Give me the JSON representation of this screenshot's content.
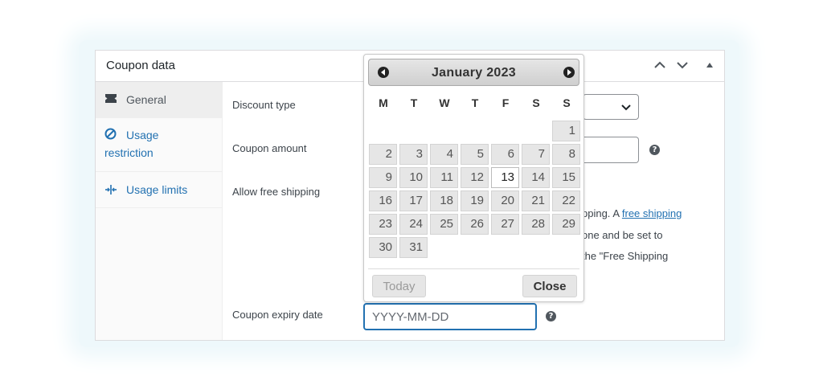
{
  "panel": {
    "title": "Coupon data"
  },
  "tabs": [
    {
      "label": "General",
      "icon": "ticket-icon",
      "active": true
    },
    {
      "label_line1": "Usage",
      "label_line2": "restriction",
      "icon": "block-icon"
    },
    {
      "label": "Usage limits",
      "icon": "limits-icon"
    }
  ],
  "fields": {
    "discount_type_label": "Discount type",
    "coupon_amount_label": "Coupon amount",
    "free_shipping_label": "Allow free shipping",
    "expiry_label": "Coupon expiry date",
    "expiry_placeholder": "YYYY-MM-DD"
  },
  "free_shipping_desc": {
    "line1_prefix": "pping. A ",
    "line1_link": "free shipping",
    "line2": "one and be set to",
    "line3": "the \"Free Shipping"
  },
  "datepicker": {
    "month_title": "January 2023",
    "weekdays": [
      "M",
      "T",
      "W",
      "T",
      "F",
      "S",
      "S"
    ],
    "first_weekday_index": 6,
    "days_in_month": 31,
    "today": 13,
    "today_button": "Today",
    "close_button": "Close"
  },
  "colors": {
    "link": "#2271b1",
    "focus_border": "#2271b1"
  }
}
